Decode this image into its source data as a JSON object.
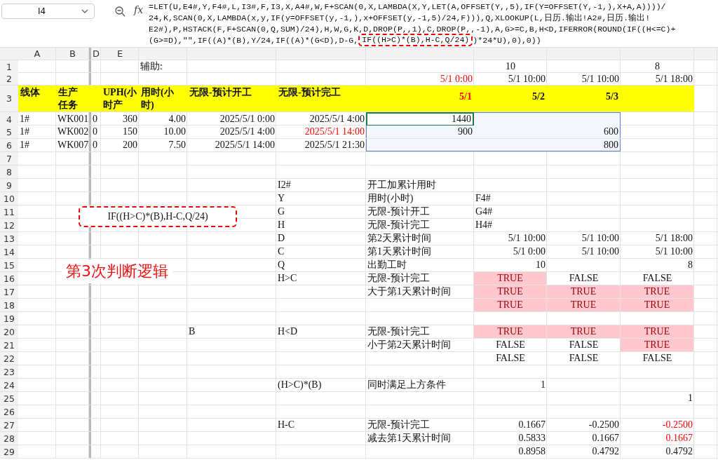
{
  "name_box": {
    "value": "I4"
  },
  "fx_label": "fx",
  "formula_lines": [
    {
      "text": "=LET(U,E4#,Y,F4#,L,I3#,F,I3,X,A4#,W,F+SCAN(0,X,LAMBDA(X,Y,LET(A,OFFSET(Y,,5),IF(Y=OFFSET(Y,-1,),X+A,A))))/"
    },
    {
      "text": "24,K,SCAN(0,X,LAMBDA(x,y,IF(y=OFFSET(y,-1,),x+OFFSET(y,-1,5)/24,F))),Q,XLOOKUP(L,日历.输出!A2#,日历.输出!"
    },
    {
      "text": "E2#),P,HSTACK(F,F+SCAN(0,Q,SUM)/24),H,W,G,K,D,DROP(P,,1),C,DROP(P,,-1),A,G>=C,B,H<D,IFERROR(ROUND(IF((H<=C)+"
    },
    {
      "text": "(G>=D),\"\",IF((A)*(B),Y/24,IF((A)*(G<D),D-G,",
      "highlight": "IF((H>C)*(B),H-C,Q/24)",
      "after": ")*24*U),0),0))"
    }
  ],
  "column_headers": {
    "A": "A",
    "B": "B",
    "D": "D",
    "E": "E"
  },
  "rows": [
    {
      "num": "1",
      "kind": "small",
      "cells": {
        "F": {
          "text": "辅助:",
          "kind": "text"
        },
        "J": {
          "text": "10",
          "kind": "center"
        },
        "L": {
          "text": "8",
          "kind": "center"
        }
      }
    },
    {
      "num": "2",
      "kind": "small",
      "cells": {
        "I": {
          "text": "5/1 0:00",
          "kind": "red"
        },
        "J": {
          "text": "5/1 10:00",
          "kind": "num"
        },
        "K": {
          "text": "5/1 10:00",
          "kind": "num"
        },
        "L": {
          "text": "5/1 18:00",
          "kind": "num"
        }
      }
    },
    {
      "num": "3",
      "kind": "header",
      "cells": {
        "A": {
          "text": "线体"
        },
        "B": {
          "text": "生产任务"
        },
        "E": {
          "text": "UPH(小时产"
        },
        "F": {
          "text": "用时(小时)"
        },
        "G": {
          "text": "无限-预计开工"
        },
        "H": {
          "text": "无限-预计完工"
        },
        "I": {
          "text": "5/1",
          "kind": "red"
        },
        "J": {
          "text": "5/2",
          "kind": "num"
        },
        "K": {
          "text": "5/3",
          "kind": "num"
        }
      }
    },
    {
      "num": "4",
      "kind": "data",
      "cells": {
        "A": {
          "text": "1#"
        },
        "B": {
          "text": "WK001"
        },
        "D": {
          "text": "0"
        },
        "E": {
          "text": "360",
          "kind": "num"
        },
        "F": {
          "text": "4.00",
          "kind": "num"
        },
        "G": {
          "text": "2025/5/1 0:00",
          "kind": "num"
        },
        "H": {
          "text": "2025/5/1 4:00",
          "kind": "num"
        },
        "I": {
          "text": "1440",
          "kind": "num",
          "selected": true,
          "active": true
        },
        "J": {
          "selected": true,
          "active": false
        },
        "K": {
          "selected": true,
          "active": false
        }
      }
    },
    {
      "num": "5",
      "kind": "data",
      "cells": {
        "A": {
          "text": "1#"
        },
        "B": {
          "text": "WK002"
        },
        "D": {
          "text": "0"
        },
        "E": {
          "text": "150",
          "kind": "num"
        },
        "F": {
          "text": "10.00",
          "kind": "num"
        },
        "G": {
          "text": "2025/5/1 4:00",
          "kind": "num"
        },
        "H": {
          "text": "2025/5/1 14:00",
          "kind": "red"
        },
        "I": {
          "text": "900",
          "kind": "num",
          "selected": true,
          "active": false
        },
        "J": {
          "selected": true,
          "active": false
        },
        "K": {
          "text": "600",
          "kind": "num",
          "selected": true,
          "active": false
        }
      }
    },
    {
      "num": "6",
      "kind": "data",
      "cells": {
        "A": {
          "text": "1#"
        },
        "B": {
          "text": "WK007"
        },
        "D": {
          "text": "0"
        },
        "E": {
          "text": "200",
          "kind": "num"
        },
        "F": {
          "text": "7.50",
          "kind": "num"
        },
        "G": {
          "text": "2025/5/1 14:00",
          "kind": "num"
        },
        "H": {
          "text": "2025/5/1 21:30",
          "kind": "num"
        },
        "I": {
          "selected": true,
          "active": false
        },
        "J": {
          "selected": true,
          "active": false
        },
        "K": {
          "text": "800",
          "kind": "num",
          "selected": true,
          "active": false
        }
      }
    },
    {
      "num": "7",
      "kind": "data"
    },
    {
      "num": "8",
      "kind": "data"
    },
    {
      "num": "9",
      "kind": "data",
      "cells": {
        "H": {
          "text": "I2#",
          "kind": "text"
        },
        "I": {
          "text": "开工加累计用时",
          "kind": "text"
        }
      }
    },
    {
      "num": "10",
      "kind": "data",
      "cells": {
        "H": {
          "text": "Y",
          "kind": "text"
        },
        "I": {
          "text": "用时(小时)",
          "kind": "text"
        },
        "J": {
          "text": "F4#",
          "kind": "text"
        }
      }
    },
    {
      "num": "11",
      "kind": "data",
      "cells": {
        "H": {
          "text": "G",
          "kind": "text"
        },
        "I": {
          "text": "无限-预计开工",
          "kind": "text"
        },
        "J": {
          "text": "G4#",
          "kind": "text"
        }
      }
    },
    {
      "num": "12",
      "kind": "data",
      "cells": {
        "H": {
          "text": "H",
          "kind": "text"
        },
        "I": {
          "text": "无限-预计完工",
          "kind": "text"
        },
        "J": {
          "text": "H4#",
          "kind": "text"
        }
      }
    },
    {
      "num": "13",
      "kind": "data",
      "cells": {
        "H": {
          "text": "D",
          "kind": "text"
        },
        "I": {
          "text": "第2天累计时间",
          "kind": "text"
        },
        "J": {
          "text": "5/1 10:00",
          "kind": "num"
        },
        "K": {
          "text": "5/1 10:00",
          "kind": "num"
        },
        "L": {
          "text": "5/1 18:00",
          "kind": "num"
        }
      }
    },
    {
      "num": "14",
      "kind": "data",
      "cells": {
        "H": {
          "text": "C",
          "kind": "text"
        },
        "I": {
          "text": "第1天累计时间",
          "kind": "text"
        },
        "J": {
          "text": "5/1 0:00",
          "kind": "num"
        },
        "K": {
          "text": "5/1 10:00",
          "kind": "num"
        },
        "L": {
          "text": "5/1 10:00",
          "kind": "num"
        }
      }
    },
    {
      "num": "15",
      "kind": "data",
      "cells": {
        "H": {
          "text": "Q",
          "kind": "text"
        },
        "I": {
          "text": "出勤工时",
          "kind": "text"
        },
        "J": {
          "text": "10",
          "kind": "num"
        },
        "L": {
          "text": "8",
          "kind": "num"
        }
      }
    },
    {
      "num": "16",
      "kind": "data",
      "cells": {
        "H": {
          "text": "H>C",
          "kind": "text"
        },
        "I": {
          "text": "无限-预计完工",
          "kind": "text"
        },
        "J": {
          "text": "TRUE",
          "kind": "flag"
        },
        "K": {
          "text": "FALSE",
          "kind": "center"
        },
        "L": {
          "text": "FALSE",
          "kind": "center"
        }
      }
    },
    {
      "num": "17",
      "kind": "data",
      "cells": {
        "I": {
          "text": "大于第1天累计时间",
          "kind": "text"
        },
        "J": {
          "text": "TRUE",
          "kind": "flag"
        },
        "K": {
          "text": "TRUE",
          "kind": "flag"
        },
        "L": {
          "text": "TRUE",
          "kind": "flag"
        }
      }
    },
    {
      "num": "18",
      "kind": "data",
      "cells": {
        "J": {
          "text": "TRUE",
          "kind": "flag"
        },
        "K": {
          "text": "TRUE",
          "kind": "flag"
        },
        "L": {
          "text": "TRUE",
          "kind": "flag"
        }
      }
    },
    {
      "num": "19",
      "kind": "data"
    },
    {
      "num": "20",
      "kind": "data",
      "cells": {
        "G": {
          "text": "B",
          "kind": "text"
        },
        "H": {
          "text": "H<D",
          "kind": "text"
        },
        "I": {
          "text": "无限-预计完工",
          "kind": "text"
        },
        "J": {
          "text": "TRUE",
          "kind": "flag"
        },
        "K": {
          "text": "TRUE",
          "kind": "flag"
        },
        "L": {
          "text": "TRUE",
          "kind": "flag"
        }
      }
    },
    {
      "num": "21",
      "kind": "data",
      "cells": {
        "I": {
          "text": "小于第2天累计时间",
          "kind": "text"
        },
        "J": {
          "text": "FALSE",
          "kind": "center"
        },
        "K": {
          "text": "FALSE",
          "kind": "center"
        },
        "L": {
          "text": "TRUE",
          "kind": "flag"
        }
      }
    },
    {
      "num": "22",
      "kind": "data",
      "cells": {
        "J": {
          "text": "FALSE",
          "kind": "center"
        },
        "K": {
          "text": "FALSE",
          "kind": "center"
        },
        "L": {
          "text": "FALSE",
          "kind": "center"
        }
      }
    },
    {
      "num": "23",
      "kind": "data"
    },
    {
      "num": "24",
      "kind": "data",
      "cells": {
        "H": {
          "text": "(H>C)*(B)",
          "kind": "text"
        },
        "I": {
          "text": "同时满足上方条件",
          "kind": "text"
        },
        "J": {
          "text": "1",
          "kind": "num"
        }
      }
    },
    {
      "num": "25",
      "kind": "data",
      "cells": {
        "L": {
          "text": "1",
          "kind": "num"
        }
      }
    },
    {
      "num": "26",
      "kind": "data"
    },
    {
      "num": "27",
      "kind": "data",
      "cells": {
        "H": {
          "text": "H-C",
          "kind": "text"
        },
        "I": {
          "text": "无限-预计完工",
          "kind": "text"
        },
        "J": {
          "text": "0.1667",
          "kind": "num"
        },
        "K": {
          "text": "-0.2500",
          "kind": "num"
        },
        "L": {
          "text": "-0.2500",
          "kind": "red"
        }
      }
    },
    {
      "num": "28",
      "kind": "data",
      "cells": {
        "I": {
          "text": "减去第1天累计时间",
          "kind": "text"
        },
        "J": {
          "text": "0.5833",
          "kind": "num"
        },
        "K": {
          "text": "0.1667",
          "kind": "num"
        },
        "L": {
          "text": "0.1667",
          "kind": "red"
        }
      }
    },
    {
      "num": "29",
      "kind": "data",
      "cells": {
        "J": {
          "text": "0.8958",
          "kind": "num"
        },
        "K": {
          "text": "0.4792",
          "kind": "num"
        },
        "L": {
          "text": "0.4792",
          "kind": "num"
        }
      }
    }
  ],
  "annotations": [
    {
      "kind": "boxed",
      "text": "IF((H>C)*(B),H-C,Q/24)"
    },
    {
      "kind": "title",
      "text": "第3次判断逻辑"
    }
  ]
}
